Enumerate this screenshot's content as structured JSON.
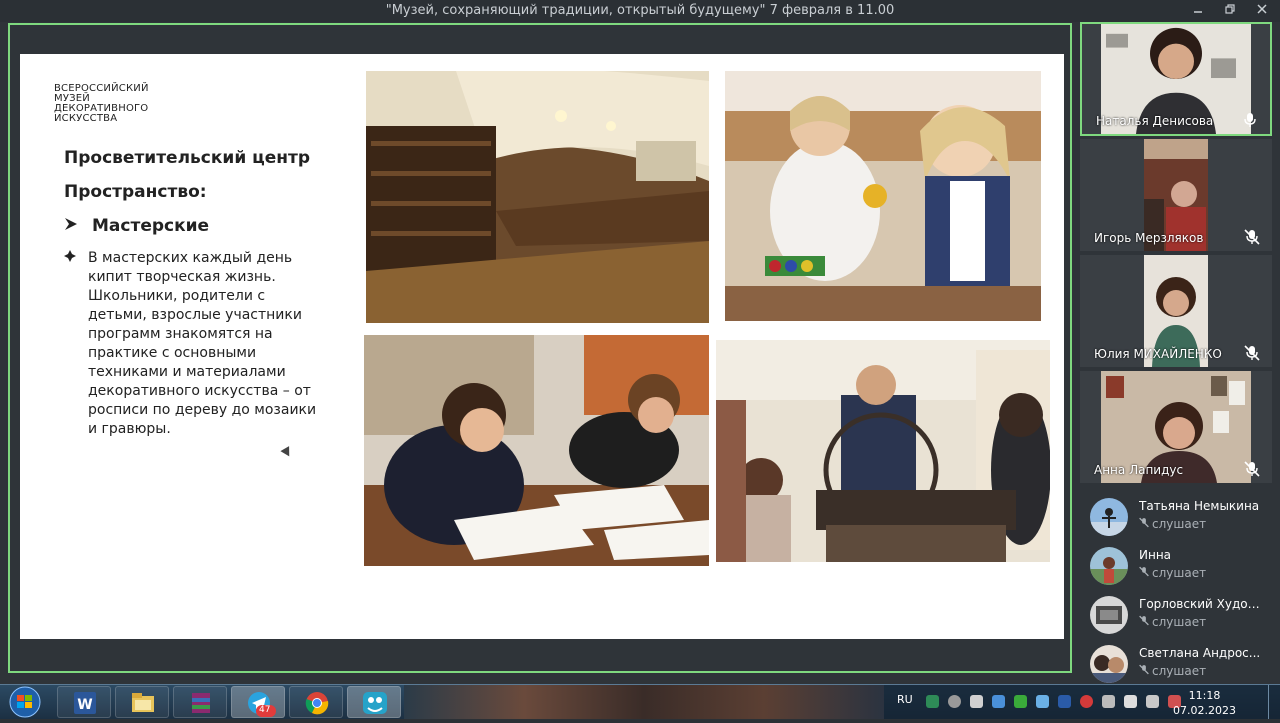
{
  "window": {
    "title": "\"Музей, сохраняющий традиции, открытый будущему\" 7 февраля в 11.00",
    "controls": [
      "minimize-icon",
      "restore-icon",
      "close-icon"
    ]
  },
  "slide": {
    "logo_lines": [
      "ВСЕРОССИЙСКИЙ",
      "МУЗЕЙ",
      "ДЕКОРАТИВНОГО",
      "ИСКУССТВА"
    ],
    "heading": "Просветительский центр",
    "subheading": "Пространство:",
    "section": "Мастерские",
    "body": "В мастерских каждый день кипит творческая жизнь. Школьники, родители с детьми, взрослые участники программ знакомятся на практике с основными техниками и материалами декоративного искусства – от росписи по дереву до мозаики и гравюры."
  },
  "participants": [
    {
      "name": "Наталья Денисова",
      "mic": "mic-on",
      "active": true
    },
    {
      "name": "Игорь Мерзляков",
      "mic": "mic-muted"
    },
    {
      "name": "Юлия МИХАЙЛЕНКО",
      "mic": "mic-muted"
    },
    {
      "name": "Анна Лапидус",
      "mic": "mic-muted"
    }
  ],
  "listeners": [
    {
      "name": "Татьяна Немыкина",
      "status": "слушает"
    },
    {
      "name": "Инна",
      "status": "слушает"
    },
    {
      "name": "Горловский Художе...",
      "status": "слушает"
    },
    {
      "name": "Светлана Андрос...",
      "status": "слушает"
    }
  ],
  "taskbar": {
    "apps": [
      "windows-start-icon",
      "word-icon",
      "file-explorer-icon",
      "winrar-icon",
      "telegram-icon",
      "chrome-icon",
      "pruffme-icon"
    ],
    "telegram_badge": "47",
    "lang": "RU",
    "time": "11:18",
    "date": "07.02.2023"
  }
}
